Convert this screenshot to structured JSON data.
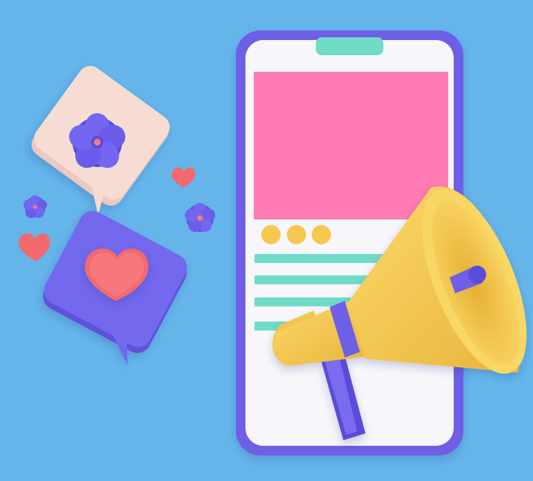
{
  "scene": {
    "colors": {
      "background": "#65B5EB",
      "phone_frame": "#6E5FE6",
      "phone_screen": "#F7F6FB",
      "notch": "#6FDCC8",
      "media_block": "#FF7BB4",
      "dots": "#F6C84F",
      "text_lines": "#6FDCC8",
      "megaphone": "#F6C84F",
      "megaphone_band": "#6E5FE6",
      "bubble_top": "#F7DCD3",
      "bubble_bottom": "#7367EE",
      "heart": "#F36A6E",
      "flower": "#6E5FE6",
      "flower_center": "#F07A87"
    },
    "icons": [
      "smartphone-icon",
      "megaphone-icon",
      "speech-bubble-icon",
      "heart-icon",
      "flower-icon"
    ]
  }
}
